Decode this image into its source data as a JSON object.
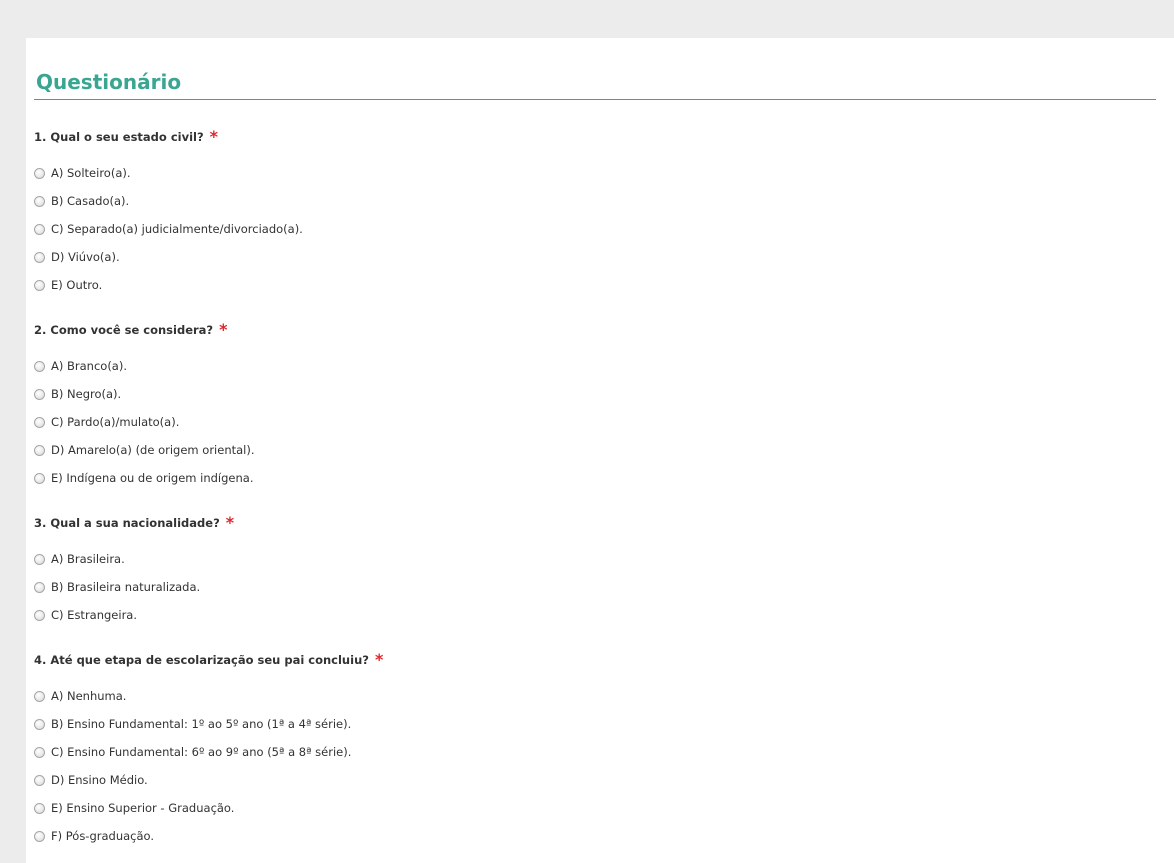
{
  "page": {
    "title": "Questionário",
    "required_marker": "*"
  },
  "colors": {
    "accent": "#3aa692",
    "required": "#e0262b",
    "background": "#ececec",
    "panel": "#ffffff"
  },
  "questions": [
    {
      "label": "1. Qual o seu estado civil?",
      "options": [
        "A) Solteiro(a).",
        "B) Casado(a).",
        "C) Separado(a) judicialmente/divorciado(a).",
        "D) Viúvo(a).",
        "E) Outro."
      ]
    },
    {
      "label": "2. Como você se considera?",
      "options": [
        "A) Branco(a).",
        "B) Negro(a).",
        "C) Pardo(a)/mulato(a).",
        "D) Amarelo(a) (de origem oriental).",
        "E) Indígena ou de origem indígena."
      ]
    },
    {
      "label": "3. Qual a sua nacionalidade?",
      "options": [
        "A) Brasileira.",
        "B) Brasileira naturalizada.",
        "C) Estrangeira."
      ]
    },
    {
      "label": "4. Até que etapa de escolarização seu pai concluiu?",
      "options": [
        "A) Nenhuma.",
        "B) Ensino Fundamental: 1º ao 5º ano (1ª a 4ª série).",
        "C) Ensino Fundamental: 6º ao 9º ano (5ª a 8ª série).",
        "D) Ensino Médio.",
        "E) Ensino Superior - Graduação.",
        "F) Pós-graduação."
      ]
    }
  ]
}
